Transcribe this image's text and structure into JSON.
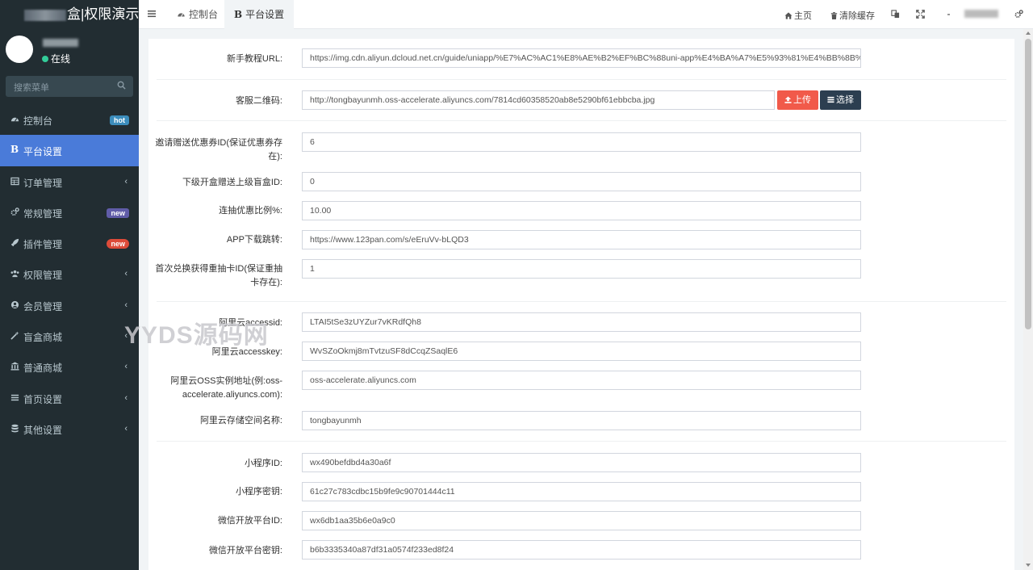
{
  "sidebar": {
    "logo_text": "盒|权限演示",
    "user_status": "在线",
    "search_placeholder": "搜索菜单",
    "items": [
      {
        "label": "控制台",
        "icon": "dashboard-icon",
        "badge": "hot",
        "badge_color": "blue",
        "active": false,
        "arrow": false
      },
      {
        "label": "平台设置",
        "icon": "bold-b-icon",
        "badge": "",
        "active": true,
        "arrow": false
      },
      {
        "label": "订单管理",
        "icon": "table-icon",
        "badge": "",
        "active": false,
        "arrow": true
      },
      {
        "label": "常规管理",
        "icon": "cogs-icon",
        "badge": "new",
        "badge_color": "purple",
        "active": false,
        "arrow": false
      },
      {
        "label": "插件管理",
        "icon": "rocket-icon",
        "badge": "new",
        "badge_color": "red",
        "active": false,
        "arrow": false
      },
      {
        "label": "权限管理",
        "icon": "group-icon",
        "badge": "",
        "active": false,
        "arrow": true
      },
      {
        "label": "会员管理",
        "icon": "user-circle-icon",
        "badge": "",
        "active": false,
        "arrow": true
      },
      {
        "label": "盲盒商城",
        "icon": "magic-icon",
        "badge": "",
        "active": false,
        "arrow": true
      },
      {
        "label": "普通商城",
        "icon": "bank-icon",
        "badge": "",
        "active": false,
        "arrow": true
      },
      {
        "label": "首页设置",
        "icon": "list-icon",
        "badge": "",
        "active": false,
        "arrow": true
      },
      {
        "label": "其他设置",
        "icon": "database-icon",
        "badge": "",
        "active": false,
        "arrow": true
      }
    ]
  },
  "header": {
    "tabs": [
      {
        "label": "控制台",
        "icon": "dashboard-icon"
      },
      {
        "label": "平台设置",
        "icon": "B"
      }
    ],
    "home_label": "主页",
    "clear_cache_label": "清除缓存"
  },
  "form": {
    "tutorial_url": {
      "label": "新手教程URL:",
      "value": "https://img.cdn.aliyun.dcloud.net.cn/guide/uniapp/%E7%AC%AC1%E8%AE%B2%EF%BC%88uni-app%E4%BA%A7%E5%93%81%E4%BB%8B%E7%BB%8"
    },
    "service_qr": {
      "label": "客服二维码:",
      "value": "http://tongbayunmh.oss-accelerate.aliyuncs.com/7814cd60358520ab8e5290bf61ebbcba.jpg",
      "upload_label": "上传",
      "choose_label": "选择"
    },
    "invite_coupon": {
      "label_line1": "邀请赠送优惠券ID(保证优惠券存",
      "label_line2": "在):",
      "value": "6"
    },
    "sub_box_gift": {
      "label": "下级开盒赠送上级盲盒ID:",
      "value": "0"
    },
    "draw_discount": {
      "label": "连抽优惠比例%:",
      "value": "10.00"
    },
    "app_download": {
      "label": "APP下载跳转:",
      "value": "https://www.123pan.com/s/eEruVv-bLQD3"
    },
    "first_redeem": {
      "label_line1": "首次兑换获得重抽卡ID(保证重抽",
      "label_line2": "卡存在):",
      "value": "1"
    },
    "ali_accessid": {
      "label": "阿里云accessid:",
      "value": "LTAI5tSe3zUYZur7vKRdfQh8"
    },
    "ali_accesskey": {
      "label": "阿里云accesskey:",
      "value": "WvSZoOkmj8mTvtzuSF8dCcqZSaqlE6"
    },
    "ali_oss": {
      "label_line1": "阿里云OSS实例地址(例:oss-",
      "label_line2": "accelerate.aliyuncs.com):",
      "value": "oss-accelerate.aliyuncs.com"
    },
    "ali_bucket": {
      "label": "阿里云存储空间名称:",
      "value": "tongbayunmh"
    },
    "mini_appid": {
      "label": "小程序ID:",
      "value": "wx490befdbd4a30a6f"
    },
    "mini_secret": {
      "label": "小程序密钥:",
      "value": "61c27c783cdbc15b9fe9c90701444c11"
    },
    "wx_open_id": {
      "label": "微信开放平台ID:",
      "value": "wx6db1aa35b6e0a9c0"
    },
    "wx_open_secret": {
      "label": "微信开放平台密钥:",
      "value": "b6b3335340a87df31a0574f233ed8f24"
    }
  },
  "watermark": "YYDS源码网",
  "colors": {
    "sidebar_bg": "#222d32",
    "active_item": "#4a7bd9",
    "upload_btn": "#f15a4a",
    "choose_btn": "#2c3e50"
  }
}
